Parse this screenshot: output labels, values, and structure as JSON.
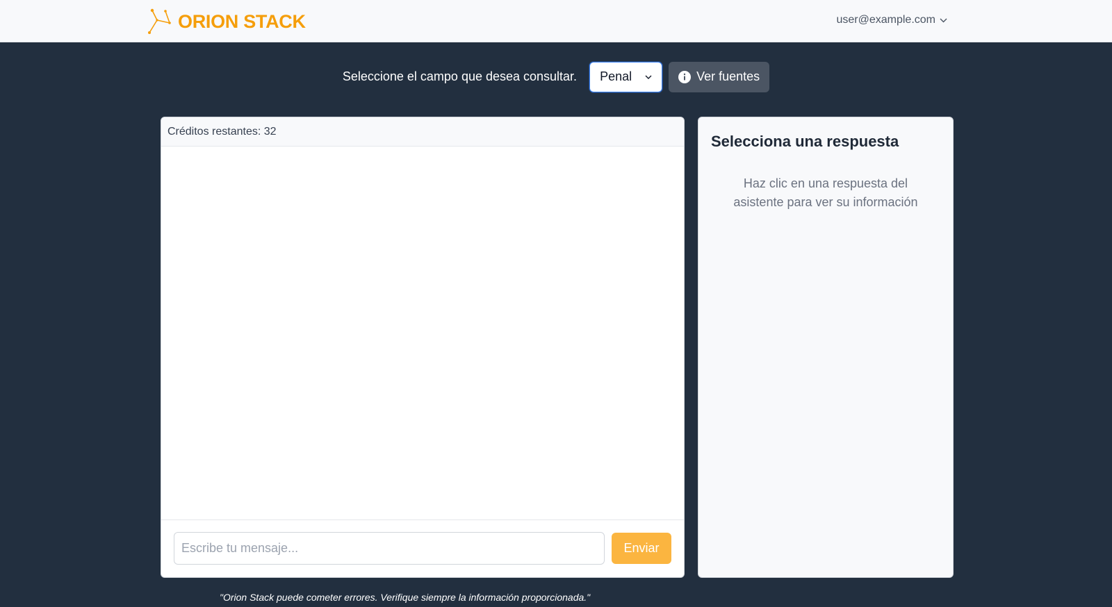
{
  "header": {
    "brand_name": "ORION STACK",
    "brand_icon": "constellation-icon",
    "user_email": "user@example.com",
    "user_menu_icon": "chevron-down-icon"
  },
  "field_selector": {
    "label": "Seleccione el campo que desea consultar.",
    "selected_value": "Penal",
    "sources_button_label": "Ver fuentes",
    "sources_button_icon": "info-icon"
  },
  "chat": {
    "credits_text": "Créditos restantes: 32",
    "input_placeholder": "Escribe tu mensaje...",
    "send_label": "Enviar"
  },
  "detail": {
    "title": "Selecciona una respuesta",
    "hint": "Haz clic en una respuesta del asistente para ver su información"
  },
  "disclaimer": "\"Orion Stack puede cometer errores. Verifique siempre la información proporcionada.\"",
  "colors": {
    "brand": "#f59e0b",
    "background": "#222f3f",
    "send_button": "#fbb540",
    "sources_button": "#4b5563",
    "focus_border": "#3b82f6"
  }
}
